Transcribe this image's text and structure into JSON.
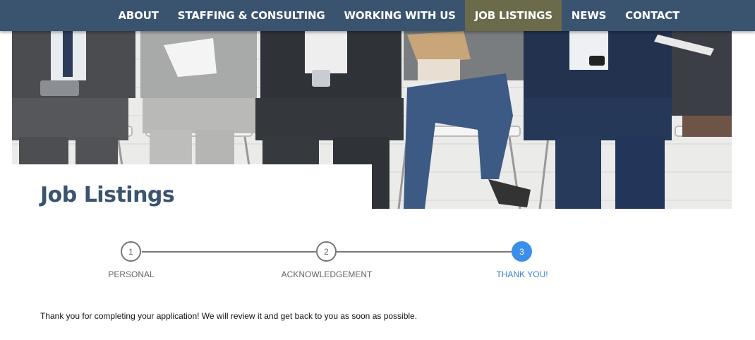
{
  "nav": {
    "items": [
      {
        "label": "ABOUT"
      },
      {
        "label": "STAFFING & CONSULTING"
      },
      {
        "label": "WORKING WITH US"
      },
      {
        "label": "JOB LISTINGS"
      },
      {
        "label": "NEWS"
      },
      {
        "label": "CONTACT"
      }
    ],
    "active_index": 3
  },
  "page": {
    "title": "Job Listings"
  },
  "stepper": {
    "steps": [
      {
        "number": "1",
        "label": "PERSONAL"
      },
      {
        "number": "2",
        "label": "ACKNOWLEDGEMENT"
      },
      {
        "number": "3",
        "label": "THANK YOU!"
      }
    ],
    "current_step": 3
  },
  "message": "Thank you for completing your application! We will review it and get back to you as soon as possible.",
  "colors": {
    "nav_bg": "#3a5470",
    "nav_active": "#6b6a4a",
    "title": "#3a5470",
    "step_active": "#3b8eea"
  }
}
